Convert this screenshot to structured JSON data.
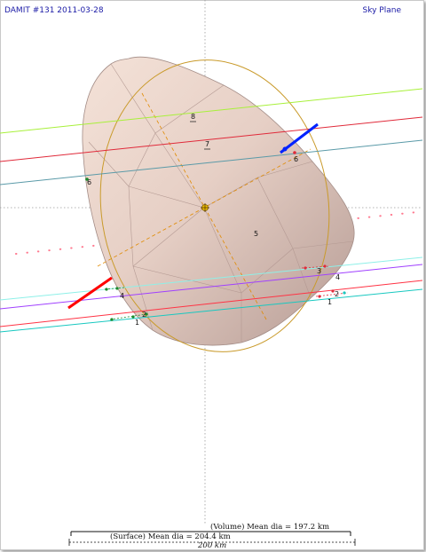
{
  "header": {
    "title": "DAMIT #131 2011-03-28",
    "view": "Sky Plane"
  },
  "chords": [
    {
      "label": "1",
      "color": "#ff3344"
    },
    {
      "label": "2",
      "color": "#18c8c0"
    },
    {
      "label": "3",
      "color": "#a040ff"
    },
    {
      "label": "4",
      "color": "#8ef0e8"
    },
    {
      "label": "5",
      "color": "#ff7799"
    },
    {
      "label": "6",
      "color": "#5a9aa8"
    },
    {
      "label": "7",
      "color": "#e02a3a"
    },
    {
      "label": "8",
      "color": "#a8f03a"
    }
  ],
  "pole_markers": {
    "negative": "#ff0000",
    "positive": "#0022ff"
  },
  "scale": {
    "volume": "(Volume) Mean dia = 197.2 km",
    "surface": "(Surface) Mean dia = 204.4 km",
    "bar": "200 km"
  },
  "colors": {
    "shape_fill": "#c9ada7",
    "ellipse": "#c99a2a",
    "axes": "#d88a00",
    "title_text": "#1a1aa6"
  }
}
